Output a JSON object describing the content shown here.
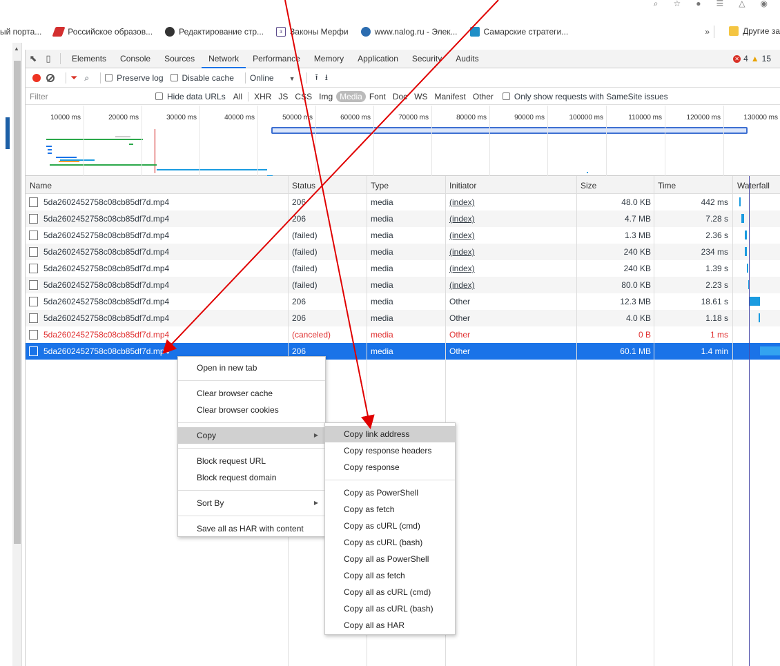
{
  "bookmarks": {
    "items": [
      {
        "label": "ый порта...",
        "color": "#ffffff"
      },
      {
        "label": "Российское образов...",
        "color": "#d32f2f"
      },
      {
        "label": "Редактирование стр...",
        "color": "#333333"
      },
      {
        "label": "Законы Мерфи",
        "color": "#5b4a8b"
      },
      {
        "label": "www.nalog.ru - Элек...",
        "color": "#2b6cb0"
      },
      {
        "label": "Самарские стратеги...",
        "color": "#1f8fc7"
      }
    ],
    "more": "»",
    "other_label": "Другие за"
  },
  "devtools": {
    "tabs": [
      "Elements",
      "Console",
      "Sources",
      "Network",
      "Performance",
      "Memory",
      "Application",
      "Security",
      "Audits"
    ],
    "active_tab": "Network",
    "errors": "4",
    "warnings": "15"
  },
  "toolbar": {
    "preserve_log": "Preserve log",
    "disable_cache": "Disable cache",
    "throttle": "Online"
  },
  "filterbar": {
    "placeholder": "Filter",
    "hide_data_urls": "Hide data URLs",
    "types": [
      "All",
      "XHR",
      "JS",
      "CSS",
      "Img",
      "Media",
      "Font",
      "Doc",
      "WS",
      "Manifest",
      "Other"
    ],
    "active_type": "Media",
    "samesite": "Only show requests with SameSite issues"
  },
  "overview": {
    "ticks": [
      "10000 ms",
      "20000 ms",
      "30000 ms",
      "40000 ms",
      "50000 ms",
      "60000 ms",
      "70000 ms",
      "80000 ms",
      "90000 ms",
      "100000 ms",
      "110000 ms",
      "120000 ms",
      "130000 ms"
    ]
  },
  "table": {
    "headers": {
      "name": "Name",
      "status": "Status",
      "type": "Type",
      "initiator": "Initiator",
      "size": "Size",
      "time": "Time",
      "waterfall": "Waterfall"
    },
    "rows": [
      {
        "name": "5da2602452758c08cb85df7d.mp4",
        "status": "206",
        "type": "media",
        "initiator": "(index)",
        "size": "48.0 KB",
        "time": "442 ms",
        "state": "normal"
      },
      {
        "name": "5da2602452758c08cb85df7d.mp4",
        "status": "206",
        "type": "media",
        "initiator": "(index)",
        "size": "4.7 MB",
        "time": "7.28 s",
        "state": "normal"
      },
      {
        "name": "5da2602452758c08cb85df7d.mp4",
        "status": "(failed)",
        "type": "media",
        "initiator": "(index)",
        "size": "1.3 MB",
        "time": "2.36 s",
        "state": "normal"
      },
      {
        "name": "5da2602452758c08cb85df7d.mp4",
        "status": "(failed)",
        "type": "media",
        "initiator": "(index)",
        "size": "240 KB",
        "time": "234 ms",
        "state": "normal"
      },
      {
        "name": "5da2602452758c08cb85df7d.mp4",
        "status": "(failed)",
        "type": "media",
        "initiator": "(index)",
        "size": "240 KB",
        "time": "1.39 s",
        "state": "normal"
      },
      {
        "name": "5da2602452758c08cb85df7d.mp4",
        "status": "(failed)",
        "type": "media",
        "initiator": "(index)",
        "size": "80.0 KB",
        "time": "2.23 s",
        "state": "normal"
      },
      {
        "name": "5da2602452758c08cb85df7d.mp4",
        "status": "206",
        "type": "media",
        "initiator": "Other",
        "size": "12.3 MB",
        "time": "18.61 s",
        "state": "normal"
      },
      {
        "name": "5da2602452758c08cb85df7d.mp4",
        "status": "206",
        "type": "media",
        "initiator": "Other",
        "size": "4.0 KB",
        "time": "1.18 s",
        "state": "normal"
      },
      {
        "name": "5da2602452758c08cb85df7d.mp4",
        "status": "(canceled)",
        "type": "media",
        "initiator": "Other",
        "size": "0 B",
        "time": "1 ms",
        "state": "canceled"
      },
      {
        "name": "5da2602452758c08cb85df7d.mp4",
        "status": "206",
        "type": "media",
        "initiator": "Other",
        "size": "60.1 MB",
        "time": "1.4 min",
        "state": "selected"
      }
    ]
  },
  "context_menu": {
    "items": [
      "Open in new tab",
      "Clear browser cache",
      "Clear browser cookies",
      "Copy",
      "Block request URL",
      "Block request domain",
      "Sort By",
      "Save all as HAR with content"
    ]
  },
  "copy_submenu": {
    "items": [
      "Copy link address",
      "Copy response headers",
      "Copy response",
      "Copy as PowerShell",
      "Copy as fetch",
      "Copy as cURL (cmd)",
      "Copy as cURL (bash)",
      "Copy all as PowerShell",
      "Copy all as fetch",
      "Copy all as cURL (cmd)",
      "Copy all as cURL (bash)",
      "Copy all as HAR"
    ]
  },
  "colors": {
    "accent": "#1a73e8",
    "error": "#d93025",
    "annotation_arrow": "#e00000"
  }
}
